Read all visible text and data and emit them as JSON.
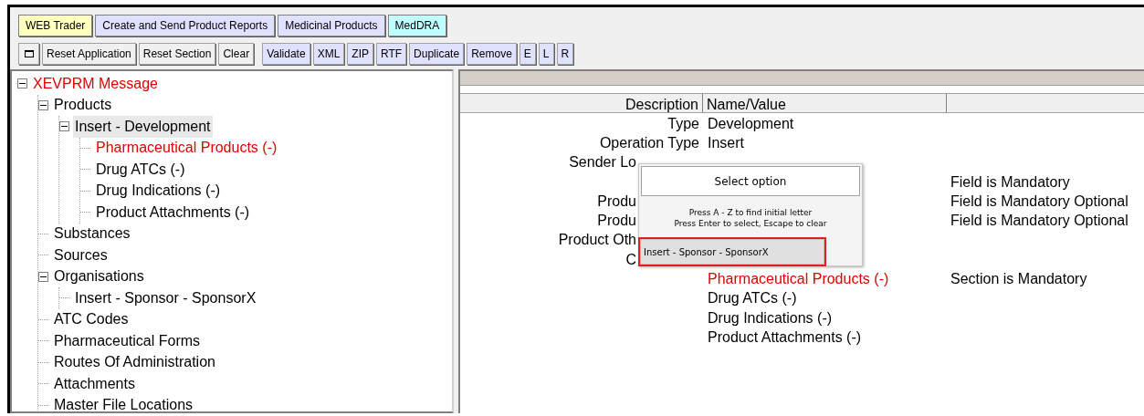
{
  "tabs": [
    {
      "label": "WEB Trader",
      "color": "#ffffc0"
    },
    {
      "label": "Create and Send Product Reports",
      "color": "#e0e0ff"
    },
    {
      "label": "Medicinal Products",
      "color": "#e0e0ff"
    },
    {
      "label": "MedDRA",
      "color": "#c0ffff"
    }
  ],
  "toolbar": [
    {
      "kind": "icon"
    },
    {
      "kind": "plain",
      "label": "Reset Application"
    },
    {
      "kind": "plain",
      "label": "Reset Section"
    },
    {
      "kind": "plain",
      "label": "Clear"
    },
    {
      "kind": "action",
      "label": "Validate"
    },
    {
      "kind": "action",
      "label": "XML"
    },
    {
      "kind": "action",
      "label": "ZIP"
    },
    {
      "kind": "action",
      "label": "RTF"
    },
    {
      "kind": "action",
      "label": "Duplicate"
    },
    {
      "kind": "action",
      "label": "Remove"
    },
    {
      "kind": "action",
      "label": "E"
    },
    {
      "kind": "action",
      "label": "L"
    },
    {
      "kind": "action",
      "label": "R"
    }
  ],
  "tree": [
    {
      "label": "XEVPRM Message",
      "error": true,
      "selected": false,
      "expanded": true,
      "children": [
        {
          "label": "Products",
          "error": false,
          "selected": false,
          "expanded": true,
          "children": [
            {
              "label": "Insert - Development",
              "error": false,
              "selected": true,
              "expanded": true,
              "children": [
                {
                  "label": "Pharmaceutical Products (-)",
                  "error": true,
                  "selected": false
                },
                {
                  "label": "Drug ATCs (-)",
                  "error": false,
                  "selected": false
                },
                {
                  "label": "Drug Indications (-)",
                  "error": false,
                  "selected": false
                },
                {
                  "label": "Product Attachments (-)",
                  "error": false,
                  "selected": false
                }
              ]
            }
          ]
        },
        {
          "label": "Substances",
          "error": false,
          "selected": false
        },
        {
          "label": "Sources",
          "error": false,
          "selected": false
        },
        {
          "label": "Organisations",
          "error": false,
          "selected": false,
          "expanded": true,
          "children": [
            {
              "label": "Insert - Sponsor - SponsorX",
              "error": false,
              "selected": false
            }
          ]
        },
        {
          "label": "ATC Codes",
          "error": false,
          "selected": false
        },
        {
          "label": "Pharmaceutical Forms",
          "error": false,
          "selected": false
        },
        {
          "label": "Routes Of Administration",
          "error": false,
          "selected": false
        },
        {
          "label": "Attachments",
          "error": false,
          "selected": false
        },
        {
          "label": "Master File Locations",
          "error": false,
          "selected": false
        }
      ]
    }
  ],
  "table": {
    "columns": [
      "Description",
      "Name/Value"
    ],
    "rows": [
      {
        "description": "Type",
        "value": "Development"
      },
      {
        "description": "Operation Type",
        "value": "Insert"
      },
      {
        "description": "Sender Lo"
      },
      {
        "note": "Field is Mandatory"
      },
      {
        "description": "Produ",
        "note": "Field is Mandatory Optional"
      },
      {
        "description": "Produ",
        "note": "Field is Mandatory Optional"
      },
      {
        "description": "Product Oth"
      },
      {
        "description": "C"
      },
      {
        "value": "Pharmaceutical Products (-)",
        "error": true,
        "note": "Section is Mandatory"
      },
      {
        "value": "Drug ATCs (-)",
        "error": false
      },
      {
        "value": "Drug Indications (-)",
        "error": false
      },
      {
        "value": "Product Attachments (-)",
        "error": false
      }
    ]
  },
  "popup": {
    "button": "Select option",
    "hints": [
      "Press A - Z to find initial letter",
      "Press Enter to select, Escape to clear"
    ],
    "options": [
      {
        "label": "Insert - Sponsor - SponsorX",
        "selected": true
      }
    ]
  }
}
